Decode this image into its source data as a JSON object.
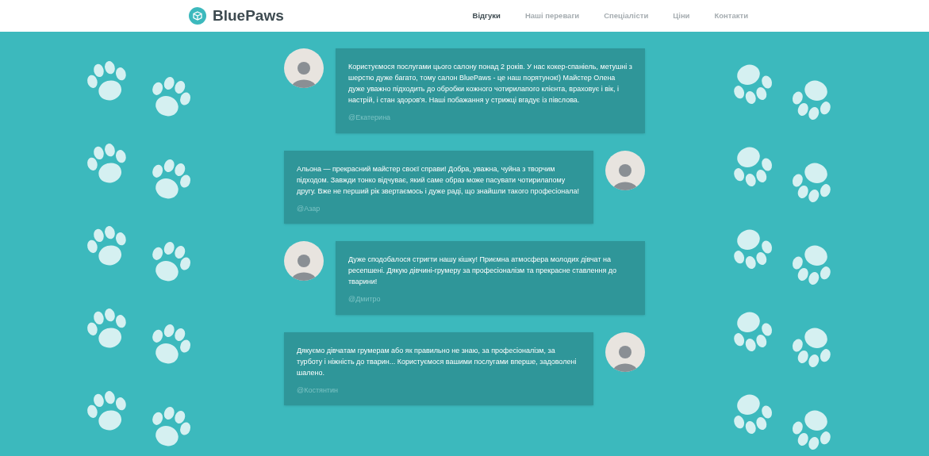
{
  "header": {
    "logo": "BluePaws",
    "nav": [
      {
        "label": "Відгуки",
        "selected": true
      },
      {
        "label": "Наші переваги",
        "selected": false
      },
      {
        "label": "Спеціалісти",
        "selected": false
      },
      {
        "label": "Ціни",
        "selected": false
      },
      {
        "label": "Контакти",
        "selected": false
      }
    ]
  },
  "reviews": [
    {
      "text": "Користуємося послугами цього салону понад 2 років. У нас кокер-спаніель, метушні з шерстю дуже багато, тому салон BluePaws - це наш порятунок!) Майстер Олена дуже уважно підходить до обробки кожного чотирилапого клієнта, враховує і вік, і настрій, і стан здоров'я. Наші побажання у стрижці вгадує із півслова.",
      "author": "@Екатерина"
    },
    {
      "text": "Альона — прекрасний майстер своєї справи! Добра, уважна, чуйна з творчим підходом. Завжди тонко відчуває, який саме образ може пасувати чотирилапому другу. Вже не перший рік звертаємось і дуже раді, що знайшли такого професіонала!",
      "author": "@Азар"
    },
    {
      "text": "Дуже сподобалося стригти нашу кішку! Приємна атмосфера молодих дівчат на ресепшені. Дякую дівчині-грумеру за професіоналізм та прекрасне ставлення до тварини!",
      "author": "@Дмитро"
    },
    {
      "text": "Дякуємо дівчатам грумерам або як правильно не знаю, за професіоналізм, за турботу і ніжність до тварин... Користуємося вашими послугами вперше, задоволені шалено.",
      "author": "@Костянтин"
    }
  ]
}
